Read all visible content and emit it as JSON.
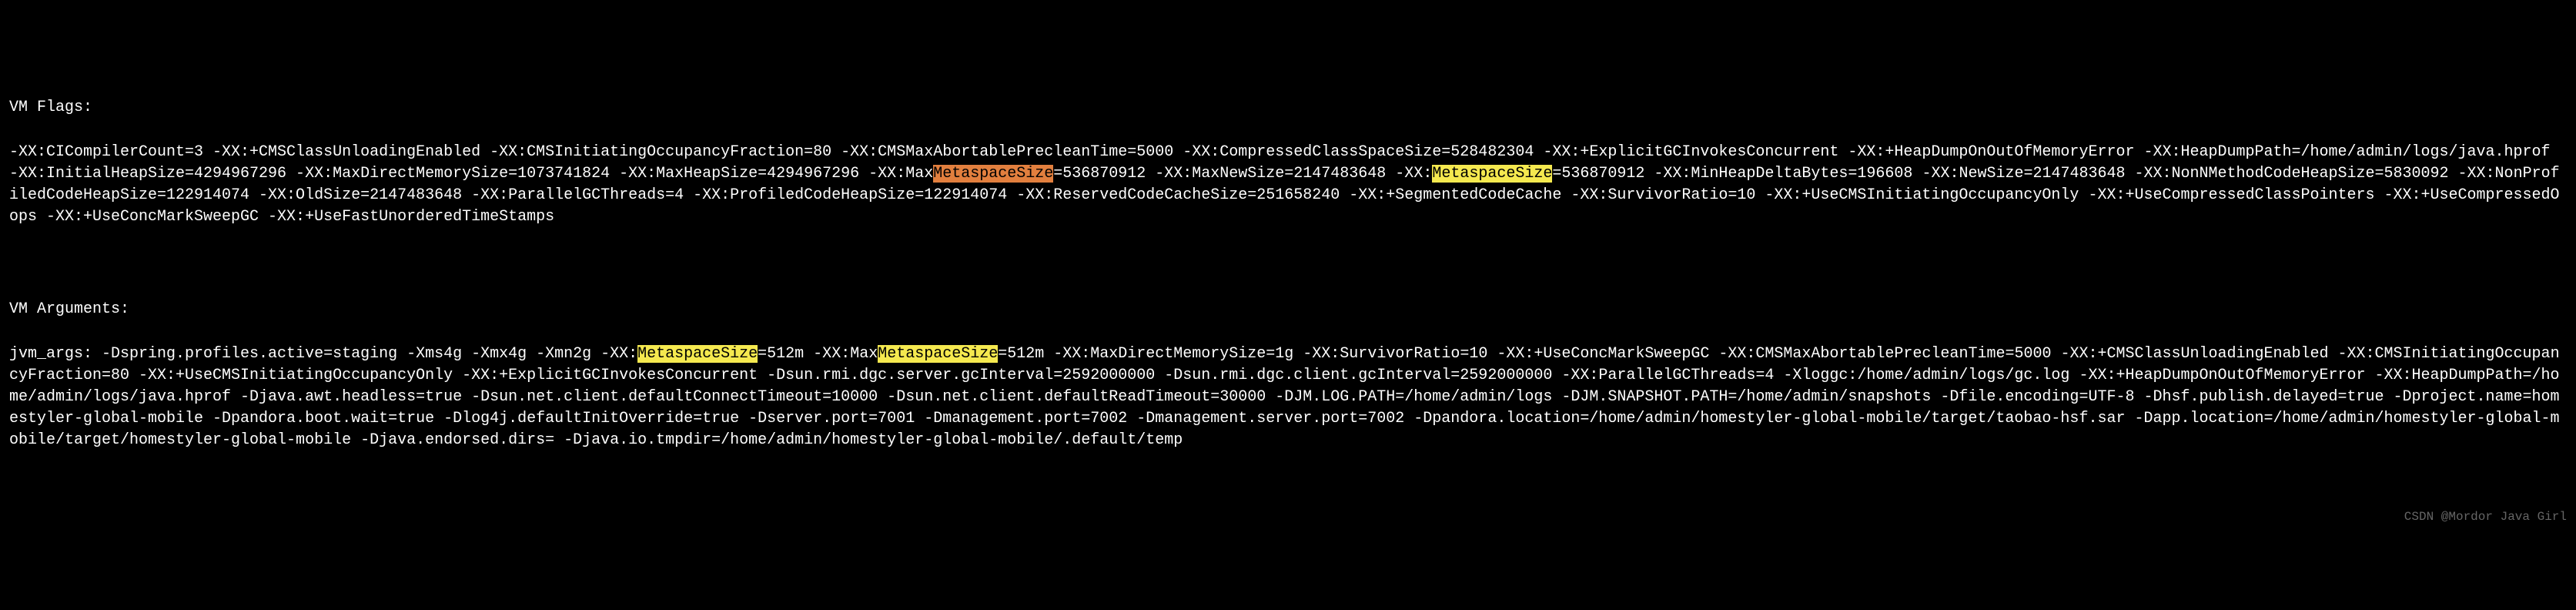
{
  "vm_flags": {
    "header": "VM Flags:",
    "seg1": "-XX:CICompilerCount=3 -XX:+CMSClassUnloadingEnabled -XX:CMSInitiatingOccupancyFraction=80 -XX:CMSMaxAbortablePrecleanTime=5000 -XX:CompressedClassSpaceSize=528482304 -XX:+ExplicitGCInvokesConcurrent -XX:+HeapDumpOnOutOfMemoryError -XX:HeapDumpPath=/home/admin/logs/java.hprof -XX:InitialHeapSize=4294967296 -XX:MaxDirectMemorySize=1073741824 -XX:MaxHeapSize=4294967296 -XX:Max",
    "hl1": "MetaspaceSize",
    "seg2": "=536870912 -XX:MaxNewSize=2147483648 -XX:",
    "hl2": "MetaspaceSize",
    "seg3": "=536870912 -XX:MinHeapDeltaBytes=196608 -XX:NewSize=2147483648 -XX:NonNMethodCodeHeapSize=5830092 -XX:NonProfiledCodeHeapSize=122914074 -XX:OldSize=2147483648 -XX:ParallelGCThreads=4 -XX:ProfiledCodeHeapSize=122914074 -XX:ReservedCodeCacheSize=251658240 -XX:+SegmentedCodeCache -XX:SurvivorRatio=10 -XX:+UseCMSInitiatingOccupancyOnly -XX:+UseCompressedClassPointers -XX:+UseCompressedOops -XX:+UseConcMarkSweepGC -XX:+UseFastUnorderedTimeStamps"
  },
  "vm_args": {
    "header": "VM Arguments:",
    "seg1": "jvm_args: -Dspring.profiles.active=staging -Xms4g -Xmx4g -Xmn2g -XX:",
    "hl1": "MetaspaceSize",
    "seg2": "=512m -XX:Max",
    "hl2": "MetaspaceSize",
    "seg3": "=512m -XX:MaxDirectMemorySize=1g -XX:SurvivorRatio=10 -XX:+UseConcMarkSweepGC -XX:CMSMaxAbortablePrecleanTime=5000 -XX:+CMSClassUnloadingEnabled -XX:CMSInitiatingOccupancyFraction=80 -XX:+UseCMSInitiatingOccupancyOnly -XX:+ExplicitGCInvokesConcurrent -Dsun.rmi.dgc.server.gcInterval=2592000000 -Dsun.rmi.dgc.client.gcInterval=2592000000 -XX:ParallelGCThreads=4 -Xloggc:/home/admin/logs/gc.log -XX:+HeapDumpOnOutOfMemoryError -XX:HeapDumpPath=/home/admin/logs/java.hprof -Djava.awt.headless=true -Dsun.net.client.defaultConnectTimeout=10000 -Dsun.net.client.defaultReadTimeout=30000 -DJM.LOG.PATH=/home/admin/logs -DJM.SNAPSHOT.PATH=/home/admin/snapshots -Dfile.encoding=UTF-8 -Dhsf.publish.delayed=true -Dproject.name=homestyler-global-mobile -Dpandora.boot.wait=true -Dlog4j.defaultInitOverride=true -Dserver.port=7001 -Dmanagement.port=7002 -Dmanagement.server.port=7002 -Dpandora.location=/home/admin/homestyler-global-mobile/target/taobao-hsf.sar -Dapp.location=/home/admin/homestyler-global-mobile/target/homestyler-global-mobile -Djava.endorsed.dirs= -Djava.io.tmpdir=/home/admin/homestyler-global-mobile/.default/temp"
  },
  "watermark": "CSDN @Mordor Java Girl"
}
